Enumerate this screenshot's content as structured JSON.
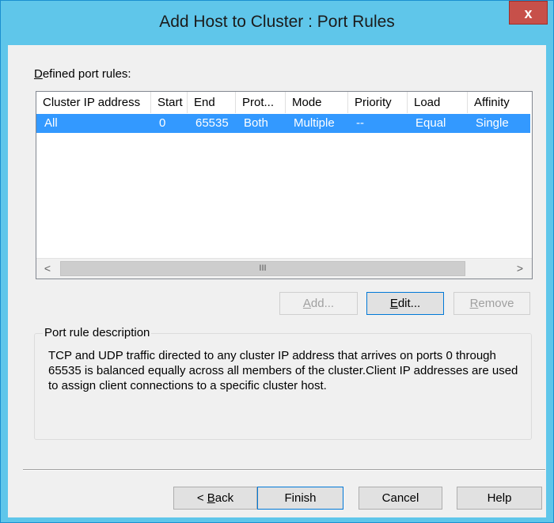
{
  "window": {
    "title": "Add Host to Cluster : Port Rules",
    "close_label": "x"
  },
  "defined_label_accel": "D",
  "defined_label_rest": "efined port rules:",
  "table": {
    "columns": [
      "Cluster IP address",
      "Start",
      "End",
      "Prot...",
      "Mode",
      "Priority",
      "Load",
      "Affinity"
    ],
    "rows": [
      [
        "All",
        "0",
        "65535",
        "Both",
        "Multiple",
        "--",
        "Equal",
        "Single"
      ]
    ]
  },
  "scrollbar": {
    "left_arrow": "<",
    "right_arrow": ">",
    "thumb_grip": "III"
  },
  "buttons": {
    "add_accel": "A",
    "add_rest": "dd...",
    "edit_accel": "E",
    "edit_rest": "dit...",
    "remove_accel": "R",
    "remove_rest": "emove",
    "back_prefix": "< ",
    "back_accel": "B",
    "back_rest": "ack",
    "finish": "Finish",
    "cancel": "Cancel",
    "help": "Help"
  },
  "description": {
    "group_label": "Port rule description",
    "text": "TCP and UDP traffic directed to any cluster IP address that arrives on ports 0 through 65535 is balanced equally across all members of the cluster.Client IP addresses are used to assign client connections to a specific cluster host."
  },
  "colors": {
    "titlebar": "#5fc6ea",
    "close": "#c7504a",
    "selection": "#3399ff"
  }
}
